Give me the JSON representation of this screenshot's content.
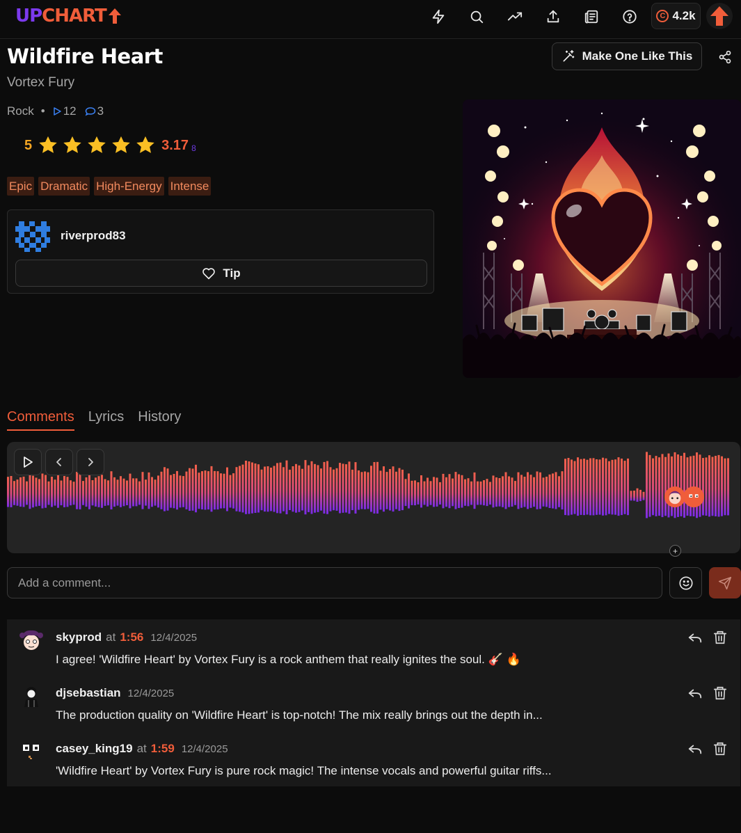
{
  "app": {
    "logo_up": "UP",
    "logo_chart": "CHART",
    "credits": "4.2k",
    "nav_icons": [
      "lightning-icon",
      "search-icon",
      "trending-icon",
      "upload-icon",
      "news-icon",
      "help-icon"
    ]
  },
  "song": {
    "title": "Wildfire Heart",
    "artist": "Vortex Fury",
    "genre": "Rock",
    "plays": "12",
    "comments_count": "3",
    "my_rating": "5",
    "avg_rating": "3.17",
    "rating_count": "8",
    "stars_filled": 5,
    "tags": [
      "Epic",
      "Dramatic",
      "High-Energy",
      "Intense"
    ]
  },
  "actions": {
    "make_one": "Make One Like This",
    "tip": "Tip"
  },
  "uploader": {
    "username": "riverprod83"
  },
  "tabs": [
    "Comments",
    "Lyrics",
    "History"
  ],
  "comment_box": {
    "placeholder": "Add a comment..."
  },
  "comments": [
    {
      "user": "skyprod",
      "at": "at",
      "time": "1:56",
      "date": "12/4/2025",
      "text": "I agree! 'Wildfire Heart' by Vortex Fury is a rock anthem that really ignites the soul. 🎸 🔥"
    },
    {
      "user": "djsebastian",
      "at": "",
      "time": "",
      "date": "12/4/2025",
      "text": "The production quality on 'Wildfire Heart' is top-notch! The mix really brings out the depth in..."
    },
    {
      "user": "casey_king19",
      "at": "at",
      "time": "1:59",
      "date": "12/4/2025",
      "text": "'Wildfire Heart' by Vortex Fury is pure rock magic! The intense vocals and powerful guitar riffs..."
    }
  ],
  "colors": {
    "accent": "#f05d3a",
    "purple": "#7c3aed",
    "star": "#fbbf24",
    "tag_bg": "#3b1d12"
  }
}
